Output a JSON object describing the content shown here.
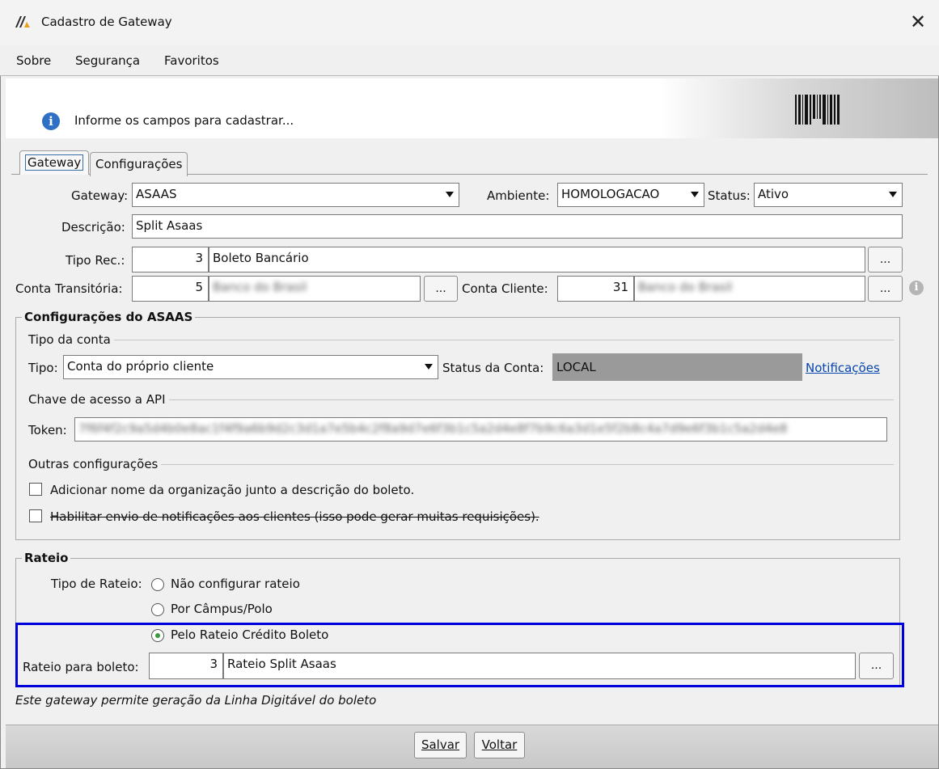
{
  "window": {
    "title": "Cadastro de Gateway",
    "close_glyph": "✕"
  },
  "menu": {
    "sobre": "Sobre",
    "seguranca": "Segurança",
    "favoritos": "Favoritos"
  },
  "banner": {
    "text": "Informe os campos para cadastrar..."
  },
  "tabs": [
    {
      "label": "Gateway",
      "active": true
    },
    {
      "label": "Configurações",
      "active": false
    }
  ],
  "form": {
    "gateway_label": "Gateway:",
    "gateway_value": "ASAAS",
    "ambiente_label": "Ambiente:",
    "ambiente_value": "HOMOLOGACAO",
    "status_label": "Status:",
    "status_value": "Ativo",
    "descricao_label": "Descrição:",
    "descricao_value": "Split Asaas",
    "tipo_rec_label": "Tipo Rec.:",
    "tipo_rec_code": "3",
    "tipo_rec_name": "Boleto Bancário",
    "conta_transitoria_label": "Conta Transitória:",
    "conta_transitoria_code": "5",
    "conta_transitoria_name": "Banco do Brasil",
    "conta_cliente_label": "Conta Cliente:",
    "conta_cliente_code": "31",
    "conta_cliente_name": "Banco do Brasil",
    "ellipsis": "..."
  },
  "asaas": {
    "group_title": "Configurações do ASAAS",
    "tipo_conta_title": "Tipo da conta",
    "tipo_label": "Tipo:",
    "tipo_value": "Conta do próprio cliente",
    "status_conta_label": "Status da Conta:",
    "status_conta_value": "LOCAL",
    "notificacoes_link": "Notificações",
    "chave_title": "Chave de acesso a API",
    "token_label": "Token:",
    "token_value": "7f6f4f2c9a5d4b0e8ac1f4f9a6b9d2c3d1a7e5b4c2f8a9d7e6f3b1c5a2d4e8f7b9c6a3d1e5f2b8c4a7d9e6f3b1c5a2d4e8",
    "outras_title": "Outras configurações",
    "chk1_label": "Adicionar nome da organização junto a descrição do boleto.",
    "chk1_checked": false,
    "chk2_label": "Habilitar envio de notificações aos clientes (isso pode gerar muitas requisições).",
    "chk2_checked": false
  },
  "rateio": {
    "group_title": "Rateio",
    "tipo_label": "Tipo de Rateio:",
    "options": [
      {
        "label": "Não configurar rateio",
        "selected": false
      },
      {
        "label": "Por Câmpus/Polo",
        "selected": false
      },
      {
        "label": "Pelo Rateio Crédito Boleto",
        "selected": true
      }
    ],
    "boleto_label": "Rateio para boleto:",
    "boleto_code": "3",
    "boleto_name": "Rateio Split Asaas"
  },
  "note": "Este gateway permite geração da Linha Digitável do boleto",
  "buttons": {
    "salvar": "Salvar",
    "voltar": "Voltar"
  },
  "colors": {
    "highlight_border": "#0000dd",
    "status_field_bg": "#9a9a9a",
    "link": "#0645ad"
  }
}
